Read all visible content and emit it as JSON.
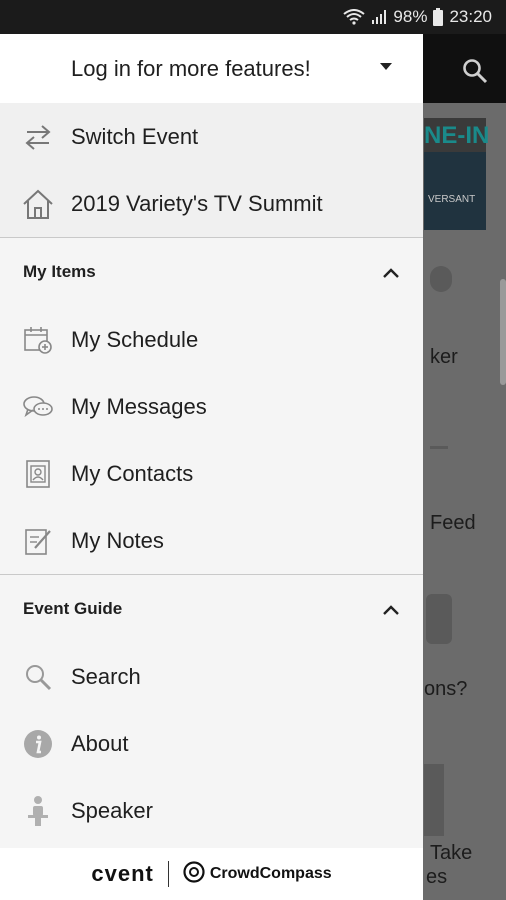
{
  "status_bar": {
    "battery": "98%",
    "time": "23:20"
  },
  "drawer": {
    "header_title": "Log in for more features!",
    "top_items": [
      {
        "label": "Switch Event",
        "icon": "switch-arrows-icon"
      },
      {
        "label": "2019 Variety's TV Summit",
        "icon": "home-icon"
      }
    ],
    "sections": [
      {
        "title": "My Items",
        "items": [
          {
            "label": "My Schedule",
            "icon": "calendar-add-icon"
          },
          {
            "label": "My Messages",
            "icon": "chat-bubbles-icon"
          },
          {
            "label": "My Contacts",
            "icon": "contact-card-icon"
          },
          {
            "label": "My Notes",
            "icon": "note-edit-icon"
          }
        ]
      },
      {
        "title": "Event Guide",
        "items": [
          {
            "label": "Search",
            "icon": "search-icon"
          },
          {
            "label": "About",
            "icon": "info-icon"
          },
          {
            "label": "Speaker",
            "icon": "person-icon"
          }
        ]
      }
    ],
    "footer": {
      "brand_left": "cvent",
      "brand_right": "CrowdCompass"
    }
  },
  "background": {
    "banner_text": "NE-IN",
    "banner_small": "VERSANT",
    "labels": [
      "ker",
      "Feed",
      "ons?",
      "Take",
      "es"
    ]
  },
  "colors": {
    "drawer_bg": "#f5f5f5",
    "overlay": "#6b6b6b",
    "toolbar": "#101010",
    "banner_accent": "#1a8a8a"
  }
}
